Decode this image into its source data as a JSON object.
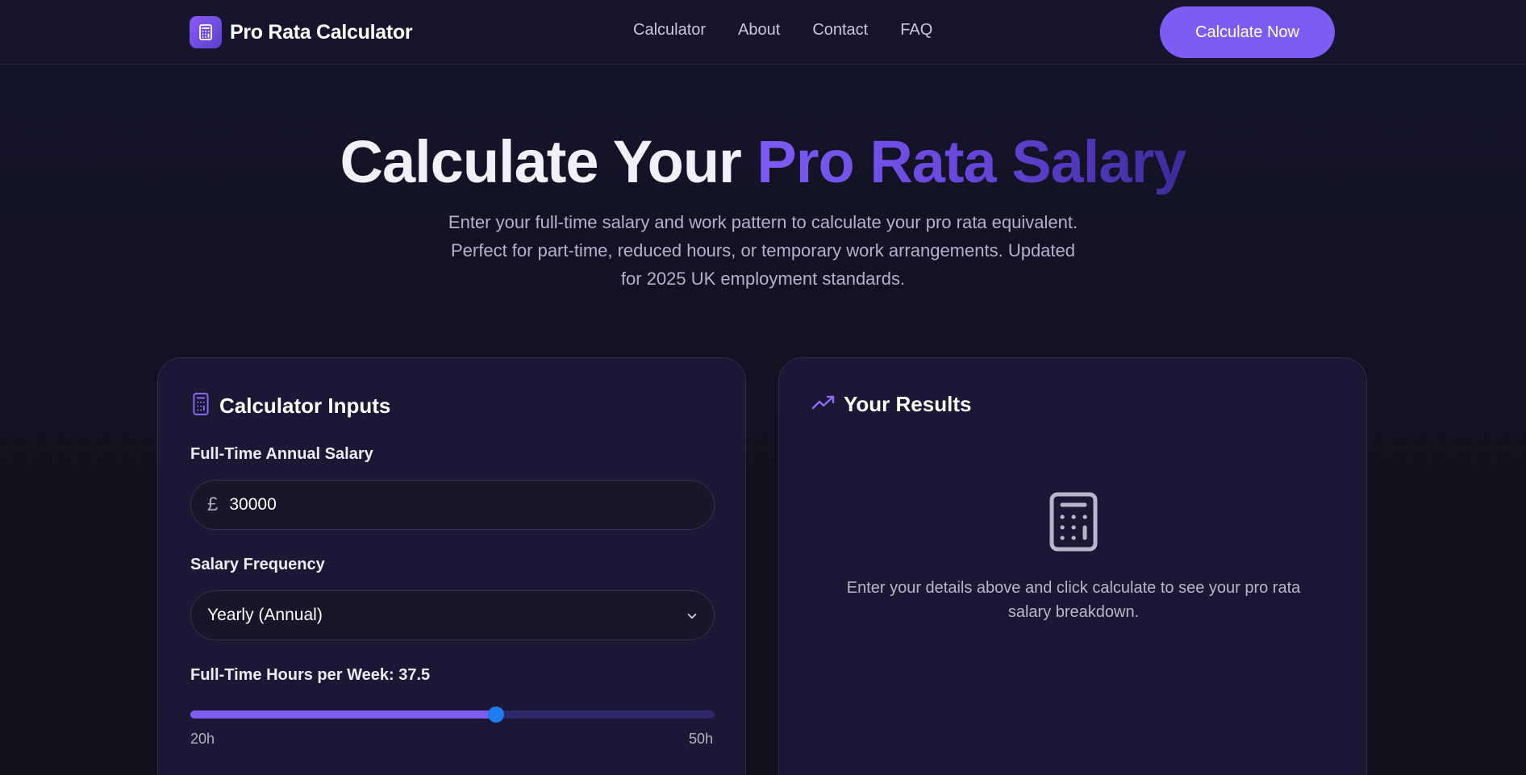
{
  "nav": {
    "brand": "Pro Rata Calculator",
    "links": [
      "Calculator",
      "About",
      "Contact",
      "FAQ"
    ],
    "cta_label": "Calculate Now"
  },
  "hero": {
    "title_plain": "Calculate Your ",
    "title_accent": "Pro Rata Salary",
    "subtitle": "Enter your full-time salary and work pattern to calculate your pro rata equivalent. Perfect for part-time, reduced hours, or temporary work arrangements. Updated for 2025 UK employment standards."
  },
  "inputs": {
    "title": "Calculator Inputs",
    "salary_label": "Full-Time Annual Salary",
    "currency_symbol": "£",
    "salary_value": "30000",
    "frequency_label": "Salary Frequency",
    "frequency_value": "Yearly (Annual)",
    "hours_label": "Full-Time Hours per Week: 37.5",
    "hours_value": 37.5,
    "hours_min": 20,
    "hours_max": 50,
    "hours_min_label": "20h",
    "hours_max_label": "50h"
  },
  "results": {
    "title": "Your Results",
    "empty_message": "Enter your details above and click calculate to see your pro rata salary breakdown."
  },
  "colors": {
    "accent": "#7c5cf4",
    "thumb": "#1e7cf2",
    "background": "#12111f",
    "card": "#1b1734"
  },
  "icons": {
    "brand": "calculator-icon",
    "inputs": "calculator-icon",
    "results": "trending-up-icon",
    "empty_state": "calculator-icon",
    "select": "chevron-down-icon"
  }
}
